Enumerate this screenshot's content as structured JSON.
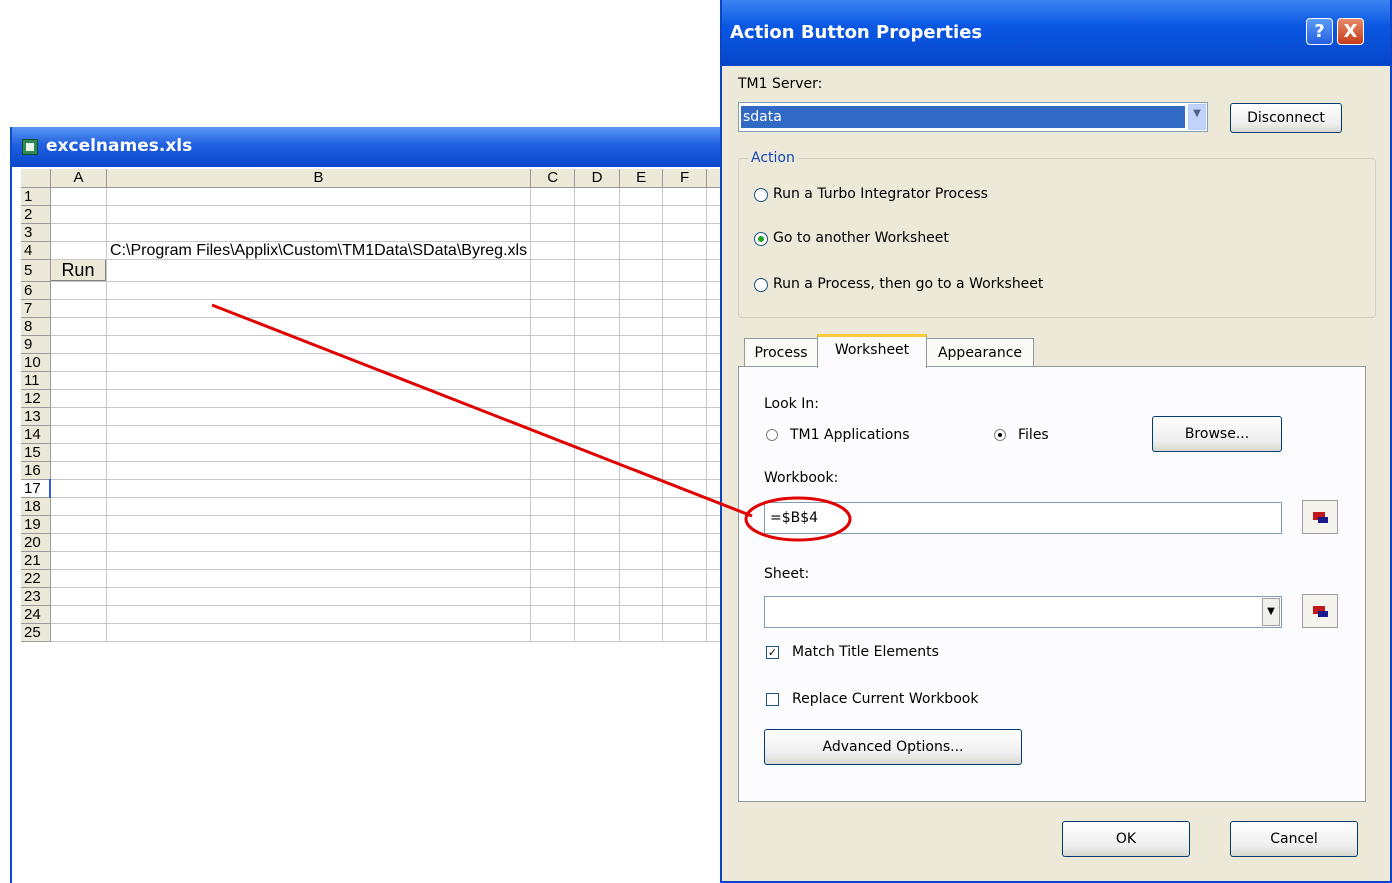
{
  "excel": {
    "title": "excelnames.xls",
    "columns": [
      "A",
      "B",
      "C",
      "D",
      "E",
      "F"
    ],
    "rows": [
      "1",
      "2",
      "3",
      "4",
      "5",
      "6",
      "7",
      "8",
      "9",
      "10",
      "11",
      "12",
      "13",
      "14",
      "15",
      "16",
      "17",
      "18",
      "19",
      "20",
      "21",
      "22",
      "23",
      "24",
      "25"
    ],
    "cell_b4": "C:\\Program Files\\Applix\\Custom\\TM1Data\\SData\\Byreg.xls",
    "run_button": "Run"
  },
  "dialog": {
    "title": "Action Button Properties",
    "help": "?",
    "close": "X",
    "server_label": "TM1 Server:",
    "server_value": "sdata",
    "disconnect": "Disconnect",
    "action_label": "Action",
    "action_options": [
      "Run a Turbo Integrator Process",
      "Go to another Worksheet",
      "Run a Process, then go to a Worksheet"
    ],
    "tabs": [
      "Process",
      "Worksheet",
      "Appearance"
    ],
    "look_in_label": "Look In:",
    "look_in_options": [
      "TM1 Applications",
      "Files"
    ],
    "browse": "Browse...",
    "workbook_label": "Workbook:",
    "workbook_value": "=$B$4",
    "sheet_label": "Sheet:",
    "sheet_value": "",
    "match_title": "Match Title Elements",
    "replace_workbook": "Replace Current Workbook",
    "advanced": "Advanced Options...",
    "ok": "OK",
    "cancel": "Cancel"
  },
  "colors": {
    "annotation": "#e00000",
    "title_bar": "#0a57e3"
  },
  "icons": {
    "excel": "excel-file-icon",
    "picker": "cell-reference-picker-icon"
  }
}
